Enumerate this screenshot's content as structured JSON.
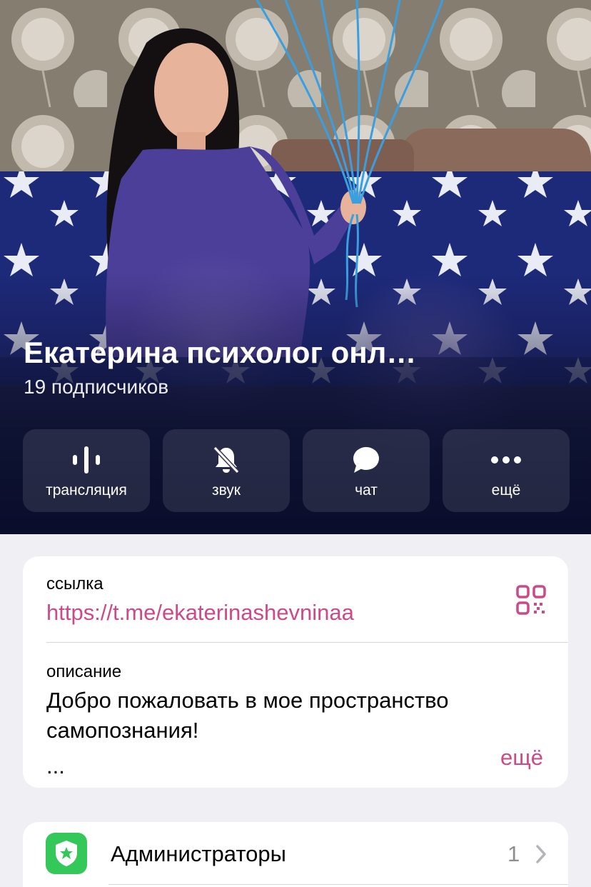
{
  "channel": {
    "name": "Екатерина психолог онл…",
    "subscribers": "19 подписчиков"
  },
  "actions": [
    {
      "label": "трансляция",
      "icon": "live-stream-icon"
    },
    {
      "label": "звук",
      "icon": "bell-muted-icon"
    },
    {
      "label": "чат",
      "icon": "chat-bubble-icon"
    },
    {
      "label": "ещё",
      "icon": "more-dots-icon"
    }
  ],
  "info": {
    "link_label": "ссылка",
    "link_value": "https://t.me/ekaterinashevninaa",
    "description_label": "описание",
    "description_text": "Добро пожаловать в мое пространство самопознания!",
    "description_ellipsis": "...",
    "more_label": "ещё"
  },
  "admins": {
    "label": "Администраторы",
    "count": "1"
  },
  "colors": {
    "accent": "#cc4a88",
    "admin_icon_bg": "#34c759",
    "background": "#efeff4"
  }
}
